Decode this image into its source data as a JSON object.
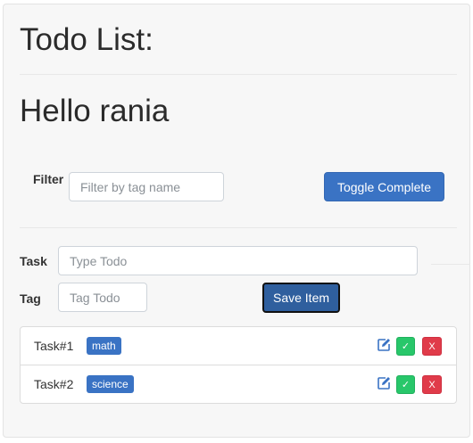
{
  "app": {
    "title": "Todo List:",
    "greeting": "Hello rania"
  },
  "filter": {
    "label": "Filter",
    "placeholder": "Filter by tag name",
    "value": "",
    "toggle_label": "Toggle Complete"
  },
  "form": {
    "task_label": "Task",
    "task_placeholder": "Type Todo",
    "task_value": "",
    "tag_label": "Tag",
    "tag_placeholder": "Tag Todo",
    "tag_value": "",
    "save_label": "Save Item"
  },
  "todos": [
    {
      "name": "Task#1",
      "tag": "math",
      "edit_icon": "edit-icon",
      "complete_label": "✓",
      "delete_label": "X"
    },
    {
      "name": "Task#2",
      "tag": "science",
      "edit_icon": "edit-icon",
      "complete_label": "✓",
      "delete_label": "X"
    }
  ],
  "colors": {
    "primary": "#3a73c4",
    "success": "#28c76a",
    "danger": "#e03b4a"
  }
}
